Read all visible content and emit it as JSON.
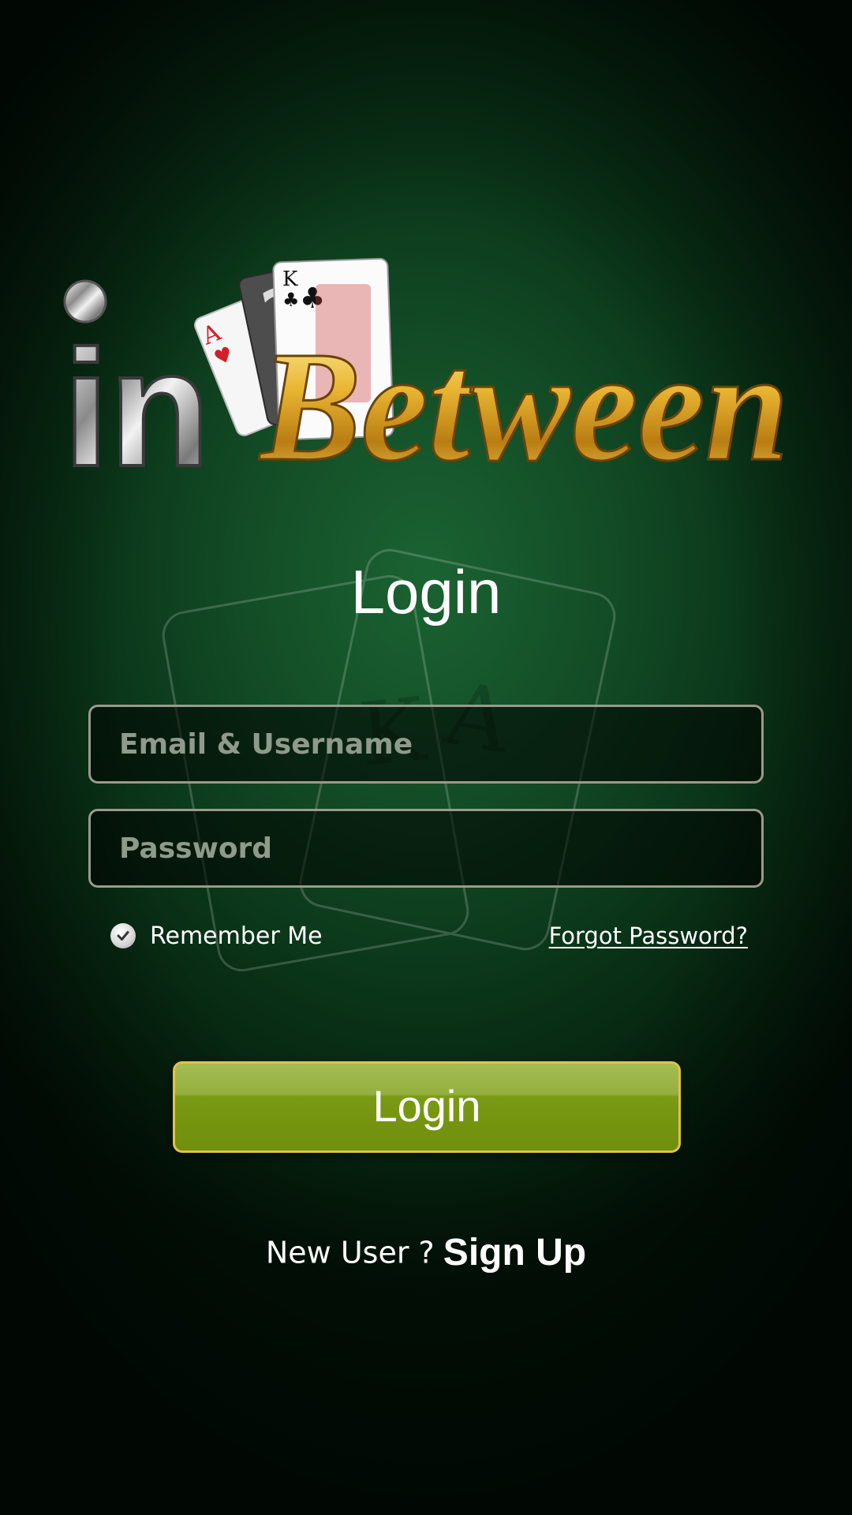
{
  "brand": {
    "logo_in": "in",
    "logo_between": "Between",
    "logo_colors": {
      "silver": "#d9d9d9",
      "gold": "#e9b532"
    }
  },
  "title": "Login",
  "form": {
    "email_placeholder": "Email & Username",
    "password_placeholder": "Password",
    "remember_label": "Remember Me",
    "remember_checked": true,
    "forgot_label": "Forgot Password?"
  },
  "login_button": "Login",
  "signup": {
    "prompt": "New User ?",
    "link": "Sign Up"
  },
  "colors": {
    "background": "#124a25",
    "button": "#7a9a14",
    "button_border": "#e2c14b"
  }
}
